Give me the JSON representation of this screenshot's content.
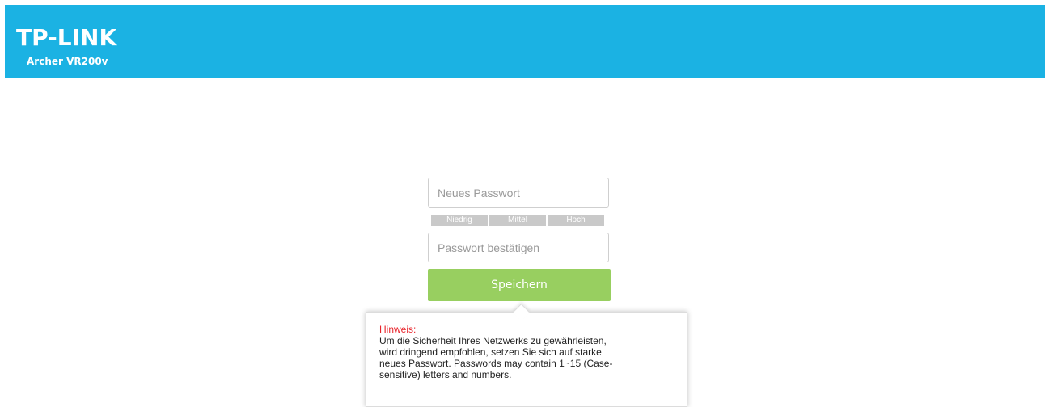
{
  "header": {
    "logo": "TP-LINK",
    "model": "Archer VR200v",
    "bg_color": "#1bb2e3"
  },
  "form": {
    "new_password_placeholder": "Neues Passwort",
    "confirm_password_placeholder": "Passwort bestätigen",
    "strength": {
      "low": "Niedrig",
      "medium": "Mittel",
      "high": "Hoch"
    },
    "save_label": "Speichern",
    "save_color": "#98cf60"
  },
  "hint": {
    "title": "Hinweis:",
    "line1": "Um die Sicherheit Ihres Netzwerks zu gewährleisten,",
    "line2": "wird dringend empfohlen, setzen Sie sich auf starke",
    "line3": "neues Passwort. Passwords may contain 1~15 (Case-",
    "line4": "sensitive) letters and numbers."
  }
}
